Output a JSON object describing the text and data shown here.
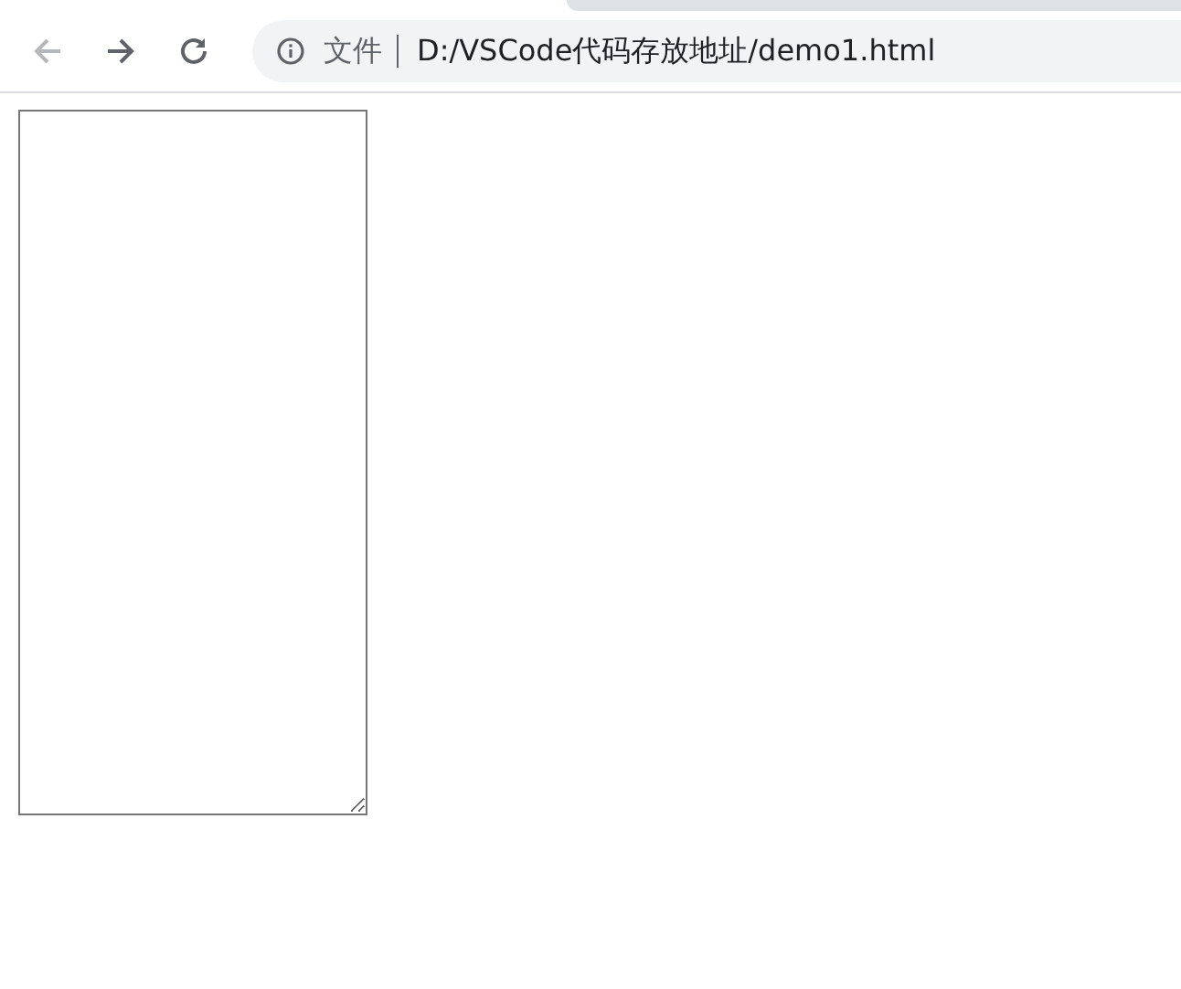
{
  "toolbar": {
    "back": {
      "disabled": true
    },
    "forward": {
      "disabled": false
    },
    "address": {
      "scheme_label": "文件",
      "url": "D:/VSCode代码存放地址/demo1.html"
    }
  }
}
